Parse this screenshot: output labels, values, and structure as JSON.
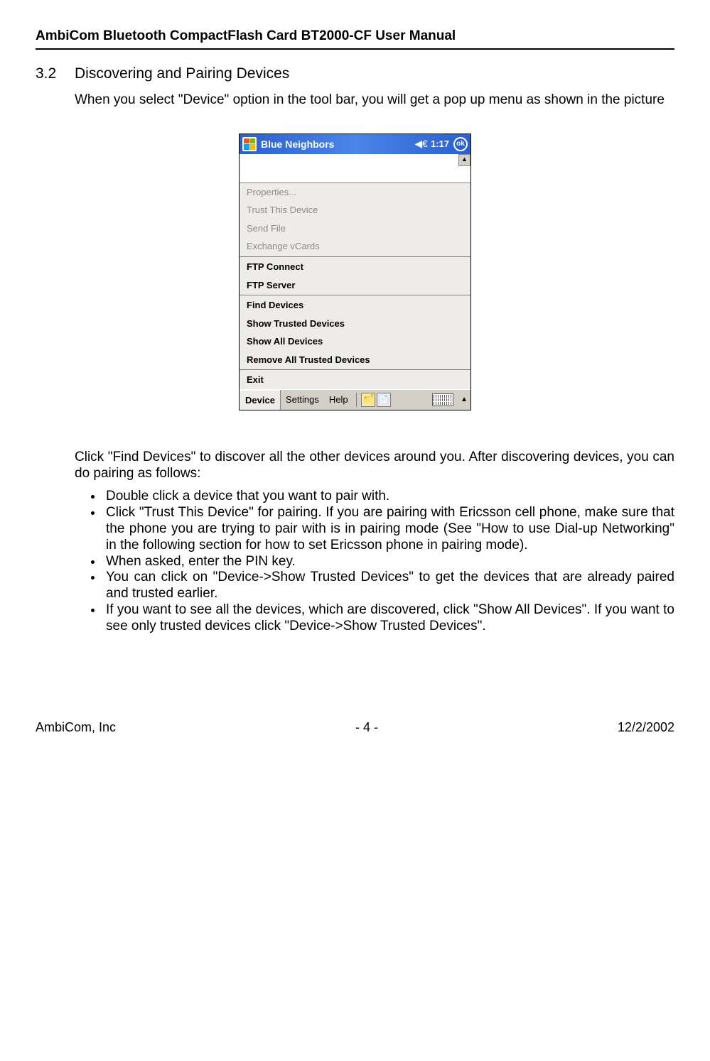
{
  "header": {
    "title": "AmbiCom Bluetooth CompactFlash Card BT2000-CF User Manual"
  },
  "section": {
    "number": "3.2",
    "title": "Discovering and Pairing Devices"
  },
  "para1": "When you select \"Device\" option in the tool bar, you will get a pop up menu as shown in the picture",
  "screenshot": {
    "title": "Blue Neighbors",
    "speaker": "◀€",
    "time": "1:17",
    "ok": "ok",
    "scroll_up": "▲",
    "menu": {
      "properties": "Properties...",
      "trust": "Trust This Device",
      "send_file": "Send File",
      "vcards": "Exchange vCards",
      "ftp_connect": "FTP Connect",
      "ftp_server": "FTP Server",
      "find": "Find Devices",
      "show_trusted": "Show Trusted Devices",
      "show_all": "Show All Devices",
      "remove_trusted": "Remove All Trusted Devices",
      "exit": "Exit"
    },
    "toolbar": {
      "device": "Device",
      "settings": "Settings",
      "help": "Help",
      "up_arrow": "↑"
    }
  },
  "para2": "Click  \"Find Devices\" to discover all the other devices around you. After discovering devices, you can do pairing as follows:",
  "bullets": {
    "b1": "Double click a device that you want to pair with.",
    "b2": "Click \"Trust This Device\" for pairing. If you are pairing with Ericsson cell phone, make sure that the phone you are trying to pair with is in pairing mode (See \"How to use Dial-up Networking\" in the following section for how to set Ericsson phone in pairing mode).",
    "b3": "When asked, enter the PIN key.",
    "b4": "You can click on \"Device->Show Trusted Devices\" to get the devices that are already paired and trusted earlier.",
    "b5": "If you want to see all the devices, which are discovered, click \"Show All Devices\". If you want to see only trusted devices click \"Device->Show Trusted Devices\"."
  },
  "footer": {
    "left": "AmbiCom, Inc",
    "center": "- 4 -",
    "right": "12/2/2002"
  }
}
